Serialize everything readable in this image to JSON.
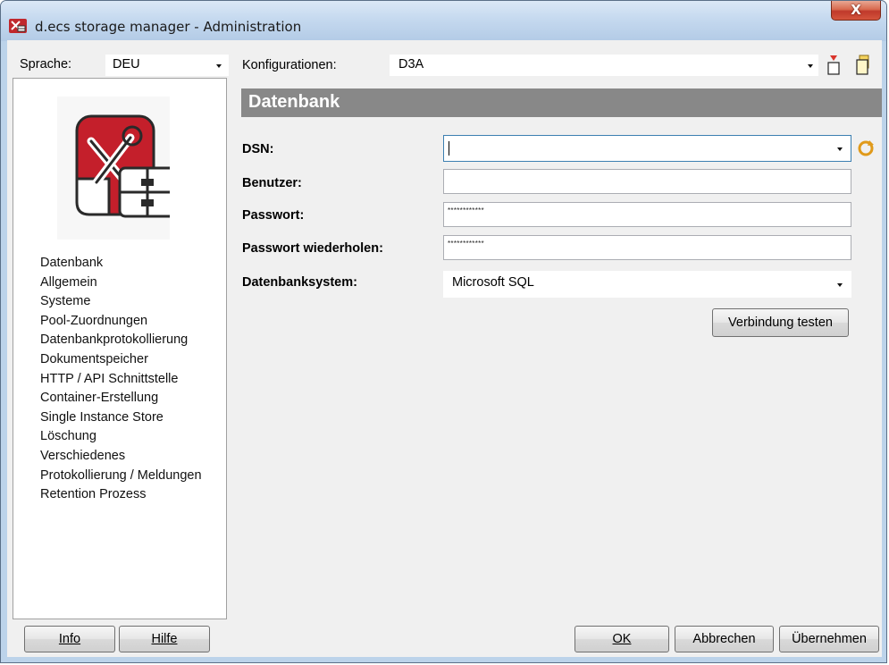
{
  "window": {
    "title": "d.ecs storage manager - Administration",
    "close_glyph": "X"
  },
  "toolbar": {
    "language_label": "Sprache:",
    "language_value": "DEU",
    "config_label": "Konfigurationen:",
    "config_value": "D3A",
    "icons": [
      "new-config-icon",
      "copy-config-icon"
    ]
  },
  "sidebar": {
    "logo": "admin-tools-logo",
    "items": [
      "Datenbank",
      "Allgemein",
      "Systeme",
      "Pool-Zuordnungen",
      "Datenbankprotokollierung",
      "Dokumentspeicher",
      "HTTP / API Schnittstelle",
      "Container-Erstellung",
      "Single Instance Store",
      "Löschung",
      "Verschiedenes",
      "Protokollierung / Meldungen",
      "Retention Prozess"
    ]
  },
  "section": {
    "title": "Datenbank"
  },
  "form": {
    "dsn_label": "DSN:",
    "dsn_value": "",
    "user_label": "Benutzer:",
    "user_value": "",
    "password_label": "Passwort:",
    "password_value": "************",
    "password_repeat_label": "Passwort wiederholen:",
    "password_repeat_value": "************",
    "dbsystem_label": "Datenbanksystem:",
    "dbsystem_value": "Microsoft SQL",
    "test_button": "Verbindung testen"
  },
  "footer": {
    "info": "Info",
    "help": "Hilfe",
    "ok": "OK",
    "cancel": "Abbrechen",
    "apply": "Übernehmen"
  },
  "colors": {
    "section_header_bg": "#888888",
    "title_bar": "#c5d9ef",
    "close_button": "#c0392b"
  }
}
